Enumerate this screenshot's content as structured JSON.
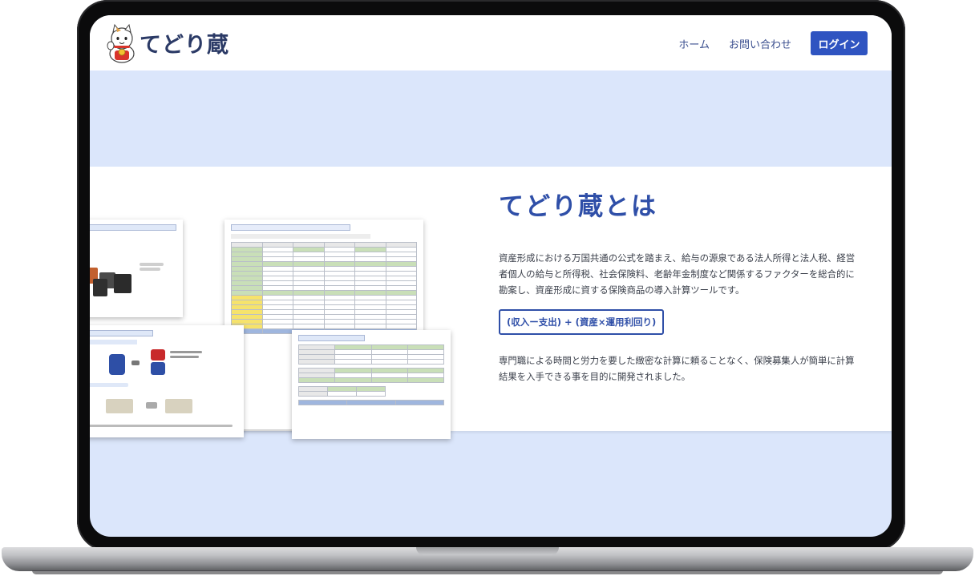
{
  "brand": {
    "name": "てどり蔵"
  },
  "nav": {
    "home": "ホーム",
    "contact": "お問い合わせ",
    "login": "ログイン"
  },
  "about": {
    "title": "てどり蔵とは",
    "description": "資産形成における万国共通の公式を踏まえ、給与の源泉である法人所得と法人税、経営者個人の給与と所得税、社会保険料、老齢年金制度など関係するファクターを総合的に勘案し、資産形成に資する保険商品の導入計算ツールです。",
    "formula": "(収入ー支出) + (資産×運用利回り)",
    "purpose": "専門職による時間と労力を要した緻密な計算に頼ることなく、保険募集人が簡単に計算結果を入手できる事を目的に開発されました。"
  },
  "colors": {
    "accent": "#2f54c1",
    "title": "#2f4fa8",
    "hero_bg": "#dbe6fb"
  }
}
